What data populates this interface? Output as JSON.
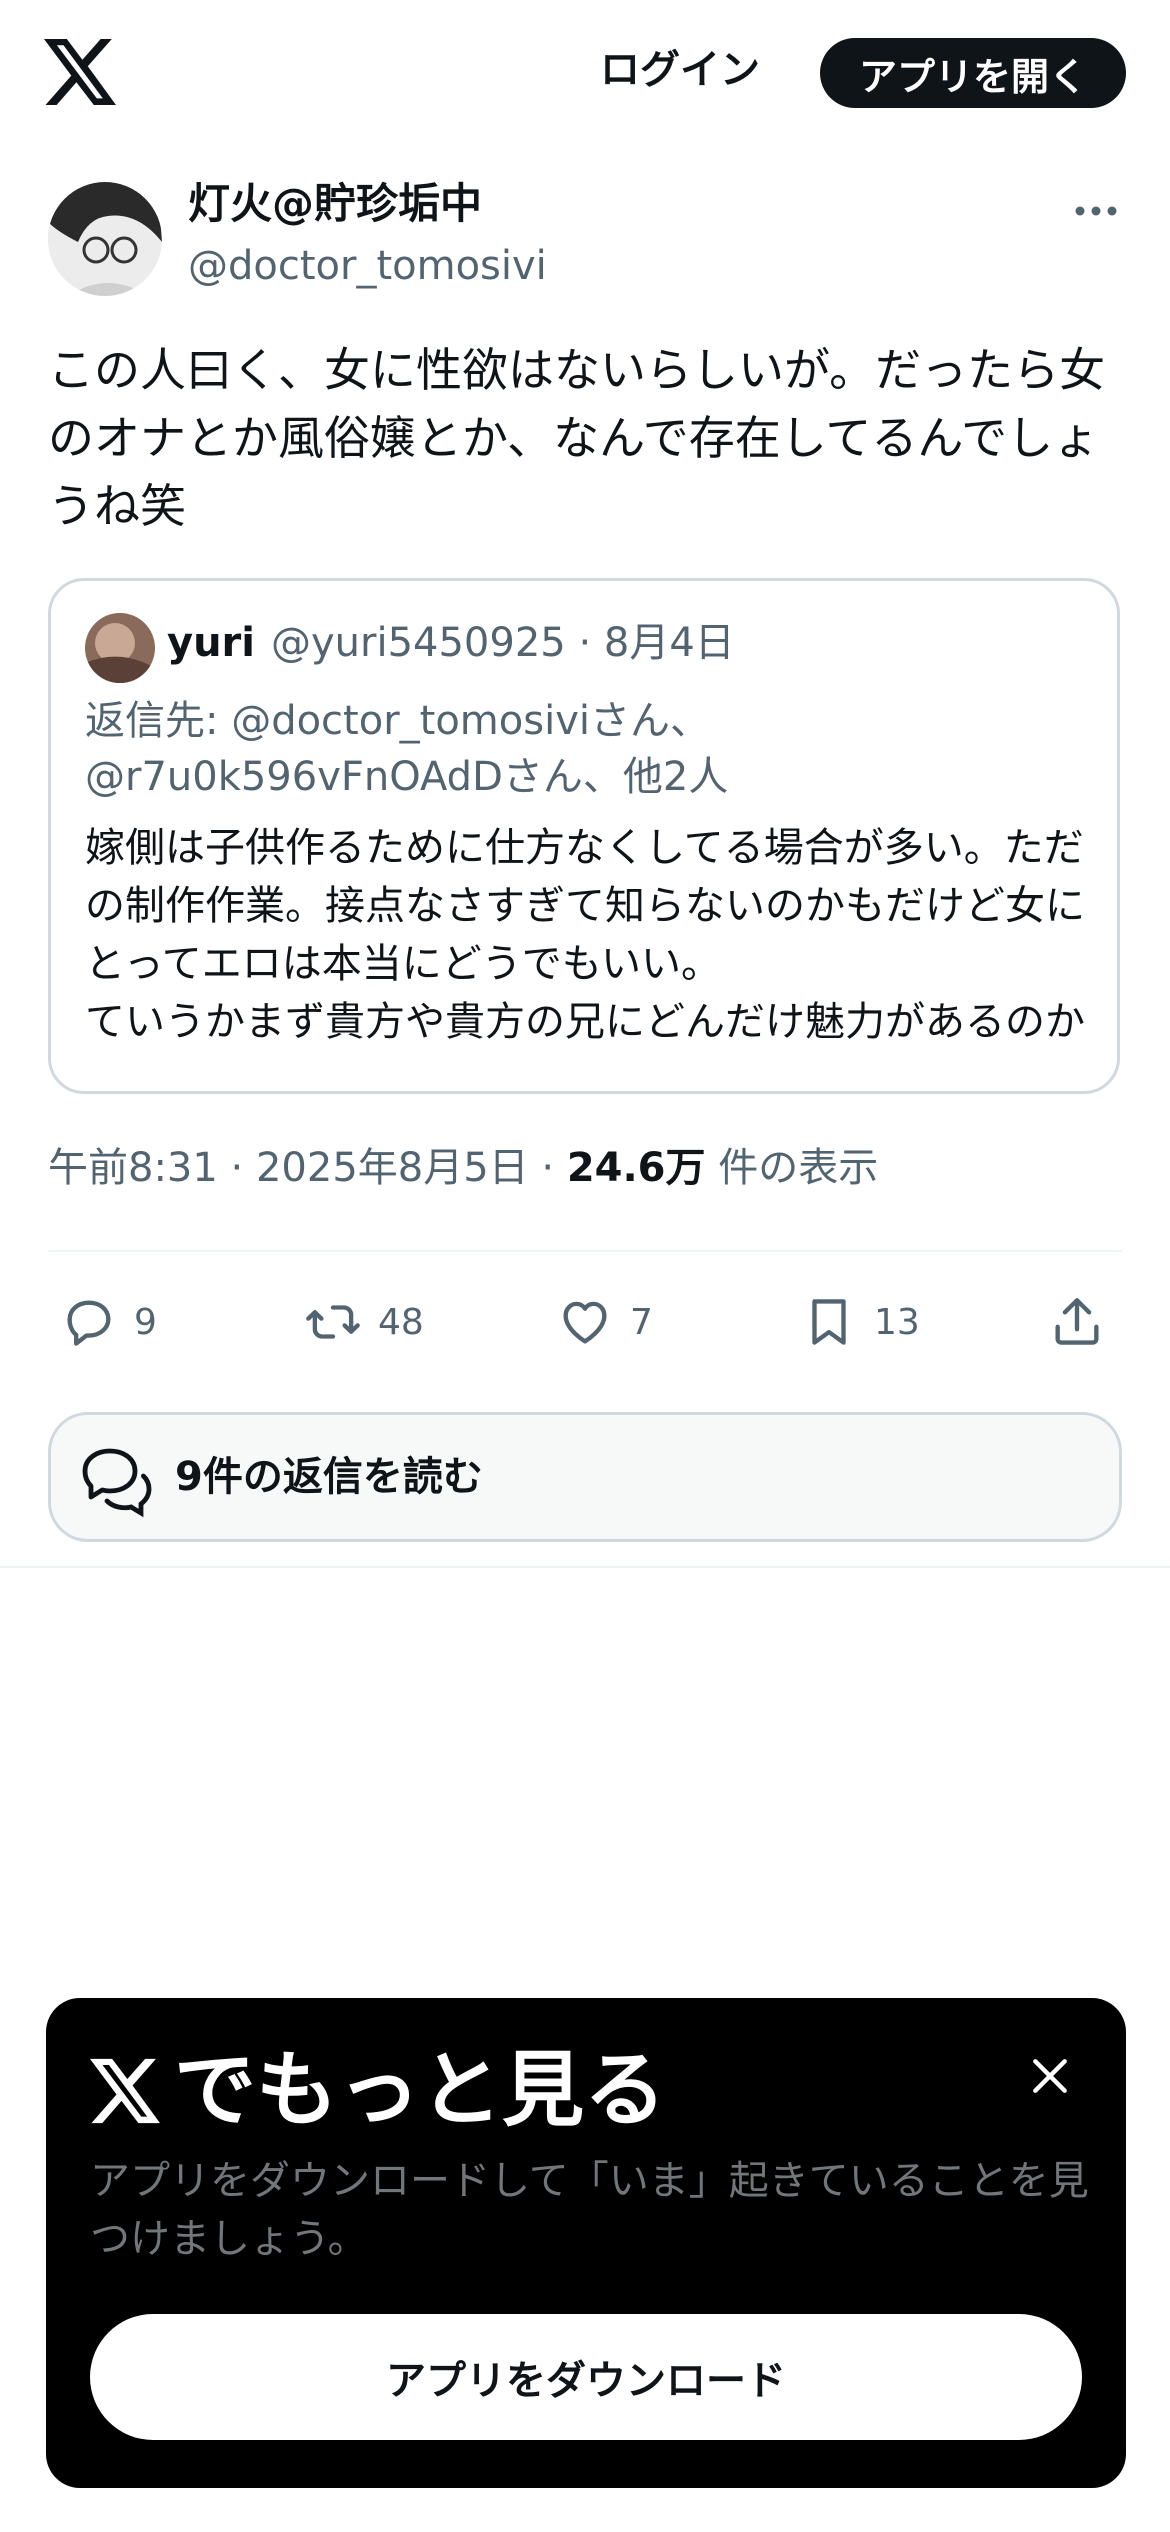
{
  "header": {
    "logo_icon": "x-logo-icon",
    "login_label": "ログイン",
    "open_app_label": "アプリを開く"
  },
  "tweet": {
    "author_name": "灯火@貯珍垢中",
    "author_handle": "@doctor_tomosivi",
    "text": "この人曰く、女に性欲はないらしいが。だったら女のオナとか風俗嬢とか、なんで存在してるんでしょうね笑",
    "quote": {
      "name": "yuri",
      "handle_date": "@yuri5450925 · 8月4日",
      "reply_to": "返信先: @doctor_tomosiviさん、@r7u0k596vFnOAdDさん、他2人",
      "text": "嫁側は子供作るために仕方なくしてる場合が多い。ただの制作作業。接点なさすぎて知らないのかもだけど女にとってエロは本当にどうでもいい。\nていうかまず貴方や貴方の兄にどんだけ魅力があるのか"
    },
    "time_date": "午前8:31 · 2025年8月5日 · ",
    "views_count": "24.6万",
    "views_label": " 件の表示",
    "actions": {
      "reply_count": "9",
      "retweet_count": "48",
      "like_count": "7",
      "bookmark_count": "13"
    },
    "read_replies_label": "9件の返信を読む"
  },
  "promo": {
    "title": "でもっと見る",
    "subtitle": "アプリをダウンロードして「いま」起きていることを見つけましょう。",
    "download_label": "アプリをダウンロード"
  },
  "colors": {
    "text_primary": "#0f1419",
    "text_secondary": "#536471",
    "border": "#cfd9de",
    "promo_bg": "#000000"
  }
}
